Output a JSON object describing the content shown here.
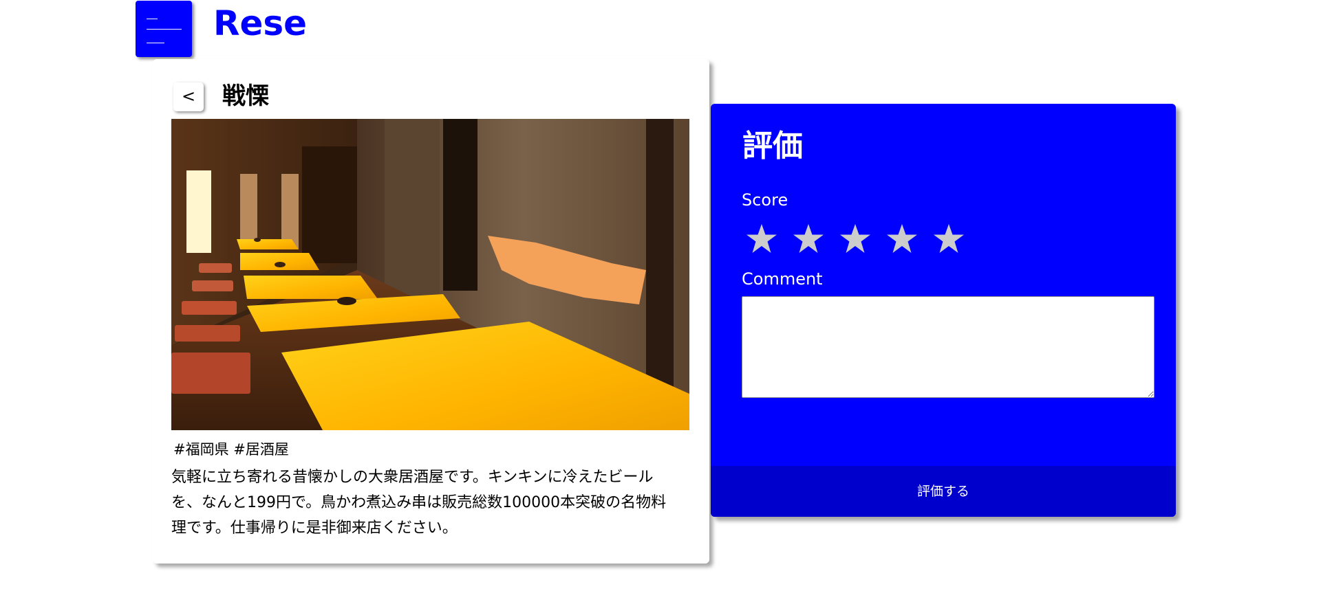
{
  "header": {
    "brand": "Rese",
    "menu_icon": "hamburger-menu-icon",
    "accent_color": "#0000ff"
  },
  "shop": {
    "back_label": "<",
    "name": "戦慄",
    "image_icon": "restaurant-interior-photo",
    "tags": "#福岡県 #居酒屋",
    "description": "気軽に立ち寄れる昔懐かしの大衆居酒屋です。キンキンに冷えたビールを、なんと199円で。鳥かわ煮込み串は販売総数100000本突破の名物料理です。仕事帰りに是非御来店ください。"
  },
  "review": {
    "title": "評価",
    "score_label": "Score",
    "rating": {
      "value": 0,
      "max": 5
    },
    "star_color": "#cccccc",
    "comment_label": "Comment",
    "comment_value": "",
    "submit_label": "評価する",
    "panel_color": "#0000ff",
    "submit_color": "#0000cd"
  }
}
